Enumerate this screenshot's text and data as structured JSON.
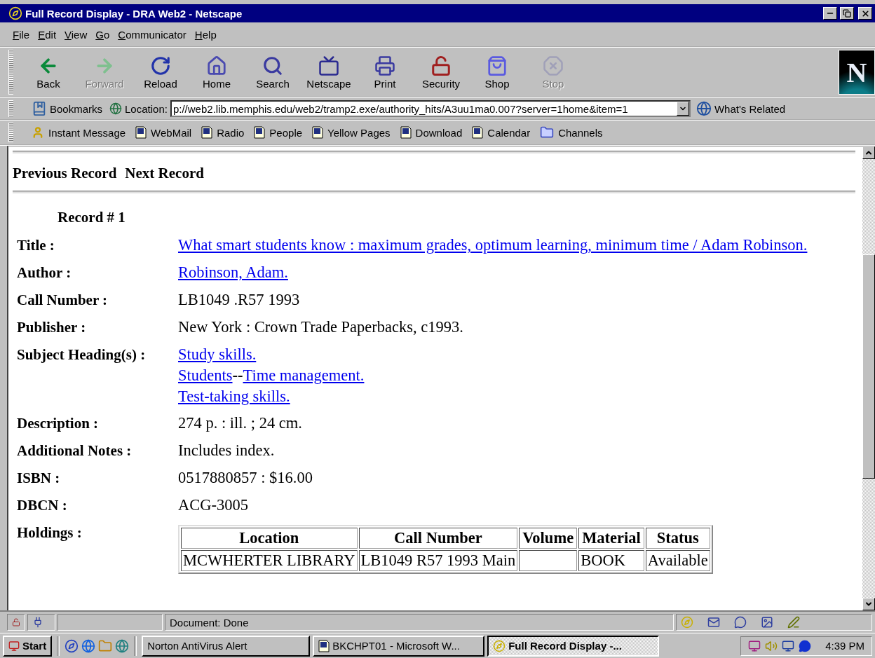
{
  "window": {
    "title": "Full Record Display - DRA Web2 - Netscape"
  },
  "menu": [
    "File",
    "Edit",
    "View",
    "Go",
    "Communicator",
    "Help"
  ],
  "toolbar": [
    {
      "label": "Back",
      "disabled": false
    },
    {
      "label": "Forward",
      "disabled": true
    },
    {
      "label": "Reload",
      "disabled": false
    },
    {
      "label": "Home",
      "disabled": false
    },
    {
      "label": "Search",
      "disabled": false
    },
    {
      "label": "Netscape",
      "disabled": false
    },
    {
      "label": "Print",
      "disabled": false
    },
    {
      "label": "Security",
      "disabled": false
    },
    {
      "label": "Shop",
      "disabled": false
    },
    {
      "label": "Stop",
      "disabled": true
    }
  ],
  "logo": "N",
  "location_bar": {
    "bookmarks": "Bookmarks",
    "label": "Location:",
    "url": "p://web2.lib.memphis.edu/web2/tramp2.exe/authority_hits/A3uu1ma0.007?server=1home&item=1",
    "related": "What's Related"
  },
  "personal_toolbar": [
    {
      "label": "Instant Message",
      "kind": "person"
    },
    {
      "label": "WebMail",
      "kind": "page"
    },
    {
      "label": "Radio",
      "kind": "page"
    },
    {
      "label": "People",
      "kind": "page"
    },
    {
      "label": "Yellow Pages",
      "kind": "page"
    },
    {
      "label": "Download",
      "kind": "page"
    },
    {
      "label": "Calendar",
      "kind": "page"
    },
    {
      "label": "Channels",
      "kind": "folder"
    }
  ],
  "page": {
    "nav_links": [
      "Previous Record",
      "Next Record"
    ],
    "record_number": "Record # 1",
    "fields": [
      {
        "label": "Title :",
        "kind": "lines",
        "lines": [
          [
            {
              "text": "What smart students know : maximum grades, optimum learning, minimum time / Adam Robinson.",
              "link": true
            }
          ]
        ]
      },
      {
        "label": "Author :",
        "kind": "lines",
        "lines": [
          [
            {
              "text": "Robinson, Adam.",
              "link": true
            }
          ]
        ]
      },
      {
        "label": "Call Number :",
        "kind": "lines",
        "lines": [
          [
            {
              "text": "LB1049 .R57 1993",
              "link": false
            }
          ]
        ]
      },
      {
        "label": "Publisher :",
        "kind": "lines",
        "lines": [
          [
            {
              "text": "New York : Crown Trade Paperbacks, c1993.",
              "link": false
            }
          ]
        ]
      },
      {
        "label": "Subject Heading(s) :",
        "kind": "lines",
        "lines": [
          [
            {
              "text": "Study skills.",
              "link": true
            }
          ],
          [
            {
              "text": "Students",
              "link": true
            },
            {
              "text": "--",
              "link": false
            },
            {
              "text": "Time management.",
              "link": true
            }
          ],
          [
            {
              "text": "Test-taking skills.",
              "link": true
            }
          ]
        ]
      },
      {
        "label": "Description :",
        "kind": "lines",
        "lines": [
          [
            {
              "text": "274 p. : ill. ; 24 cm.",
              "link": false
            }
          ]
        ]
      },
      {
        "label": "Additional Notes :",
        "kind": "lines",
        "lines": [
          [
            {
              "text": "Includes index.",
              "link": false
            }
          ]
        ]
      },
      {
        "label": "ISBN :",
        "kind": "lines",
        "lines": [
          [
            {
              "text": "0517880857 : $16.00",
              "link": false
            }
          ]
        ]
      },
      {
        "label": "DBCN :",
        "kind": "lines",
        "lines": [
          [
            {
              "text": "ACG-3005",
              "link": false
            }
          ]
        ]
      },
      {
        "label": "Holdings :",
        "kind": "table",
        "columns": [
          "Location",
          "Call Number",
          "Volume",
          "Material",
          "Status"
        ],
        "rows": [
          [
            "MCWHERTER LIBRARY",
            "LB1049 R57 1993 Main",
            "",
            "BOOK",
            "Available"
          ]
        ]
      }
    ]
  },
  "status_bar": {
    "text": "Document: Done"
  },
  "taskbar": {
    "start": "Start",
    "tasks": [
      {
        "label": "Norton AntiVirus Alert",
        "selected": false,
        "kind": "plain"
      },
      {
        "label": "BKCHPT01 - Microsoft W...",
        "selected": false,
        "kind": "word"
      },
      {
        "label": "Full Record Display -...",
        "selected": true,
        "kind": "browser"
      }
    ],
    "clock": "4:39 PM"
  }
}
